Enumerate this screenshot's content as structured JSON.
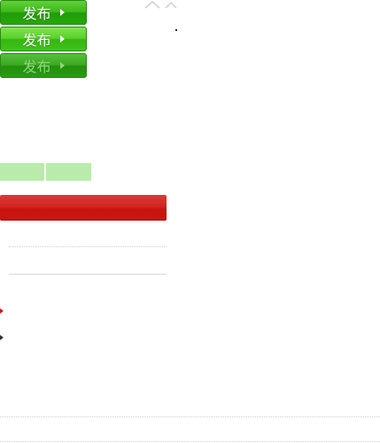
{
  "publish_buttons": [
    {
      "label": "发布",
      "state": "normal"
    },
    {
      "label": "发布",
      "state": "hover"
    },
    {
      "label": "发布",
      "state": "disabled"
    }
  ],
  "icons": {
    "button_arrow": "triangle-right-icon",
    "caret": "caret-up-icon",
    "bullet": "triangle-right-icon"
  },
  "colors": {
    "green_button": "#3cb819",
    "light_green_block": "#b9ecab",
    "red_bar": "#cc1b14",
    "dotted_line": "#cfcfcf",
    "solid_line": "#d9d9d9",
    "bullet_red": "#cc1b14",
    "bullet_dark": "#333333"
  }
}
